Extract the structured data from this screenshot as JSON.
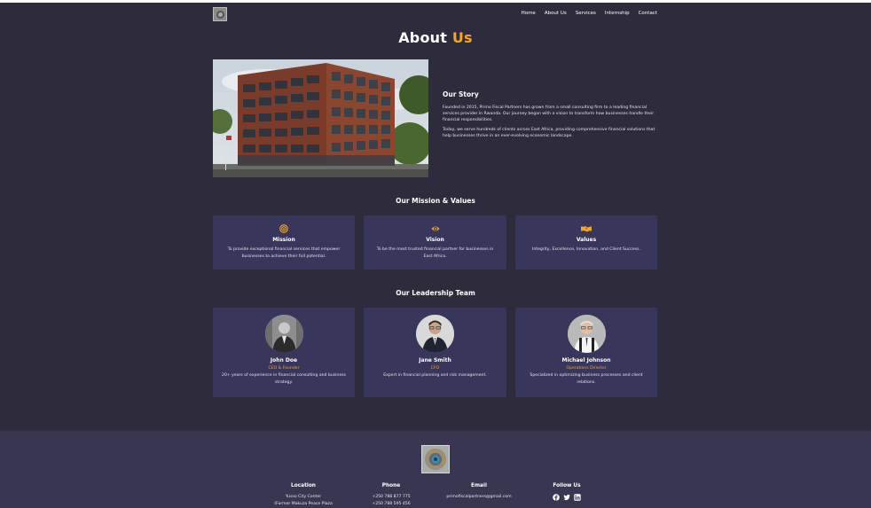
{
  "header": {
    "nav": [
      "Home",
      "About Us",
      "Services",
      "Internship",
      "Contact"
    ]
  },
  "title": {
    "main": "About",
    "accent": "Us"
  },
  "story": {
    "heading": "Our Story",
    "paragraphs": [
      "Founded in 2015, Primo Fiscal Partners has grown from a small consulting firm to a leading financial services provider in Rwanda. Our journey began with a vision to transform how businesses handle their financial responsibilities.",
      "Today, we serve hundreds of clients across East Africa, providing comprehensive financial solutions that help businesses thrive in an ever-evolving economic landscape."
    ]
  },
  "mission_section": {
    "title": "Our Mission & Values",
    "cards": [
      {
        "icon": "target-icon",
        "title": "Mission",
        "text": "To provide exceptional financial services that empower businesses to achieve their full potential."
      },
      {
        "icon": "eye-icon",
        "title": "Vision",
        "text": "To be the most trusted financial partner for businesses in East Africa."
      },
      {
        "icon": "handshake-icon",
        "title": "Values",
        "text": "Integrity, Excellence, Innovation, and Client Success."
      }
    ]
  },
  "team_section": {
    "title": "Our Leadership Team",
    "members": [
      {
        "name": "John Doe",
        "role": "CEO & Founder",
        "bio": "20+ years of experience in financial consulting and business strategy."
      },
      {
        "name": "Jane Smith",
        "role": "CFO",
        "bio": "Expert in financial planning and risk management."
      },
      {
        "name": "Michael Johnson",
        "role": "Operations Director",
        "bio": "Specialized in optimizing business processes and client relations."
      }
    ]
  },
  "footer": {
    "location": {
      "heading": "Location",
      "lines": [
        "Yusso City Center",
        "(Former Makuza Peace Plaza"
      ]
    },
    "phone": {
      "heading": "Phone",
      "lines": [
        "+250 788 877 775",
        "+250 788 595 456"
      ]
    },
    "email": {
      "heading": "Email",
      "lines": [
        "primofiscalpartners@gmail.com"
      ]
    },
    "social": {
      "heading": "Follow Us",
      "icons": [
        "facebook-icon",
        "twitter-icon",
        "linkedin-icon"
      ]
    }
  },
  "colors": {
    "background": "#2d2b3c",
    "card": "#38365a",
    "footer": "#383650",
    "accent": "#f6a623"
  }
}
